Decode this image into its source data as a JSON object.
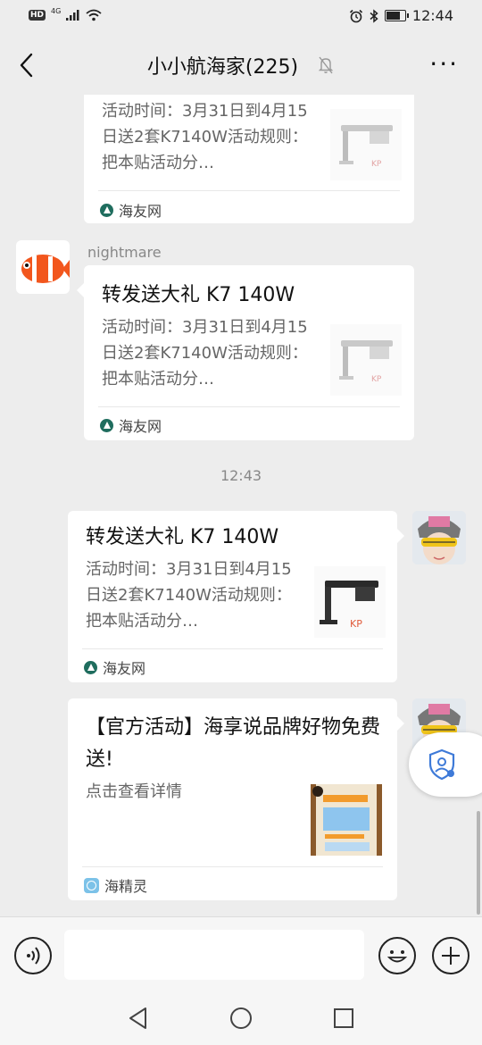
{
  "status_bar": {
    "hd": "HD",
    "network": "4G",
    "time": "12:44",
    "battery_level": 0.7
  },
  "header": {
    "title": "小小航海家(225)",
    "more": "···"
  },
  "messages": {
    "m1": {
      "desc": "活动时间：3月31日到4月15日送2套K7140W活动规则：把本贴活动分…",
      "source": "海友网"
    },
    "m2": {
      "sender": "nightmare",
      "title": "转发送大礼 K7 140W",
      "desc": "活动时间：3月31日到4月15日送2套K7140W活动规则：把本贴活动分…",
      "source": "海友网"
    },
    "timestamp": "12:43",
    "m3": {
      "title": "转发送大礼 K7 140W",
      "desc": "活动时间：3月31日到4月15日送2套K7140W活动规则：把本贴活动分…",
      "source": "海友网"
    },
    "m4": {
      "title": "【官方活动】海享说品牌好物免费送!",
      "desc": "点击查看详情",
      "source": "海精灵"
    }
  },
  "icons": {
    "back": "chevron-left-icon",
    "mute": "bell-off-icon",
    "voice": "voice-icon",
    "emoji": "emoji-icon",
    "add": "plus-icon",
    "shield": "shield-user-icon"
  }
}
